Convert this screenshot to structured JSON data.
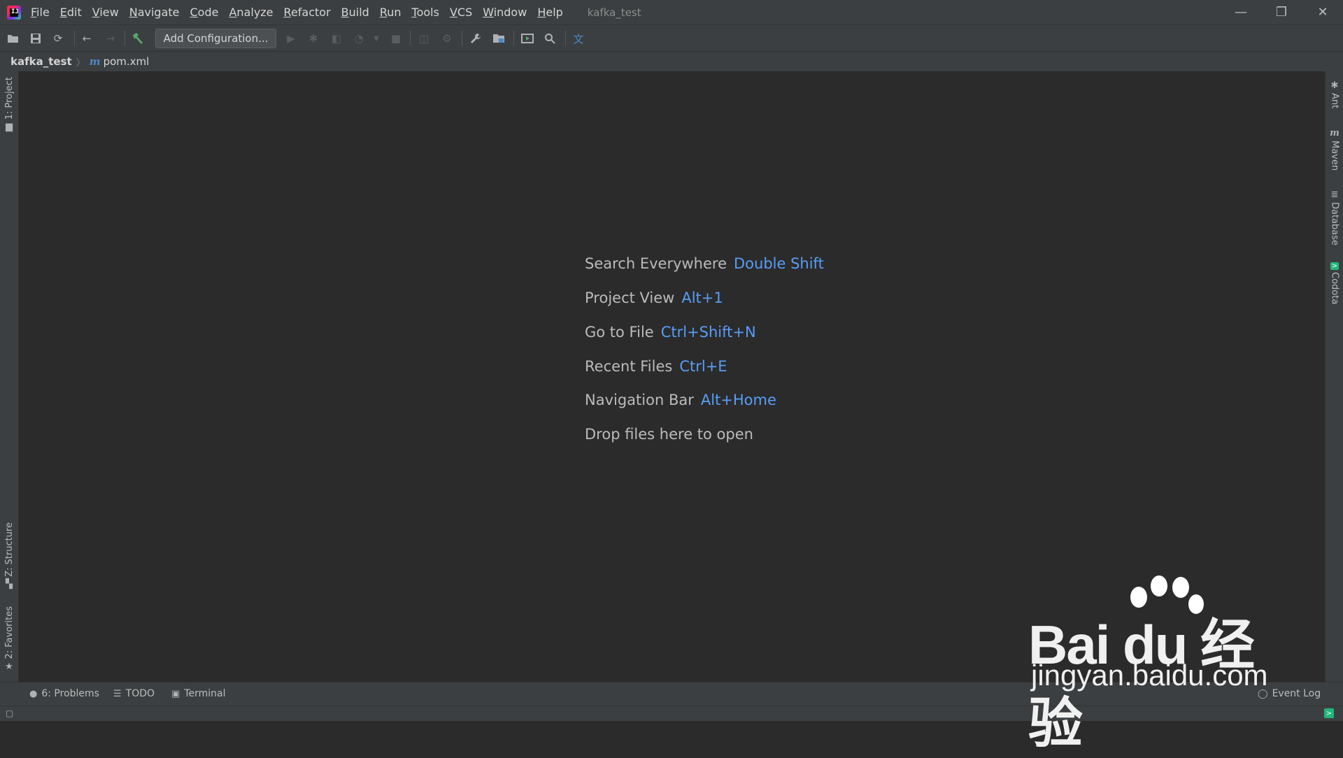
{
  "window": {
    "title": "kafka_test",
    "app_icon_label": "IJ",
    "controls": [
      "—",
      "❐",
      "✕"
    ]
  },
  "menu": [
    "File",
    "Edit",
    "View",
    "Navigate",
    "Code",
    "Analyze",
    "Refactor",
    "Build",
    "Run",
    "Tools",
    "VCS",
    "Window",
    "Help"
  ],
  "toolbar": {
    "add_configuration_label": "Add Configuration..."
  },
  "breadcrumb": {
    "project": "kafka_test",
    "separator": "〉",
    "file_icon": "m",
    "file": "pom.xml"
  },
  "left_strip": {
    "project_tab": "1: Project",
    "structure_tab": "Z: Structure",
    "favorites_tab": "2: Favorites"
  },
  "right_strip": {
    "ant_tab": "Ant",
    "maven_tab": "Maven",
    "database_tab": "Database",
    "codota_tab": "Codota"
  },
  "editor_hints": [
    {
      "label": "Search Everywhere",
      "key": "Double Shift"
    },
    {
      "label": "Project View",
      "key": "Alt+1"
    },
    {
      "label": "Go to File",
      "key": "Ctrl+Shift+N"
    },
    {
      "label": "Recent Files",
      "key": "Ctrl+E"
    },
    {
      "label": "Navigation Bar",
      "key": "Alt+Home"
    },
    {
      "label": "Drop files here to open",
      "key": ""
    }
  ],
  "bottom_tabs": {
    "problems": "6: Problems",
    "todo": "TODO",
    "terminal": "Terminal",
    "event_log": "Event Log"
  },
  "watermark": {
    "logo": "Bai du 经验",
    "url": "jingyan.baidu.com"
  },
  "colors": {
    "editor_bg": "#2b2b2b",
    "chrome_bg": "#3c3f41",
    "shortcut_blue": "#589df6"
  }
}
